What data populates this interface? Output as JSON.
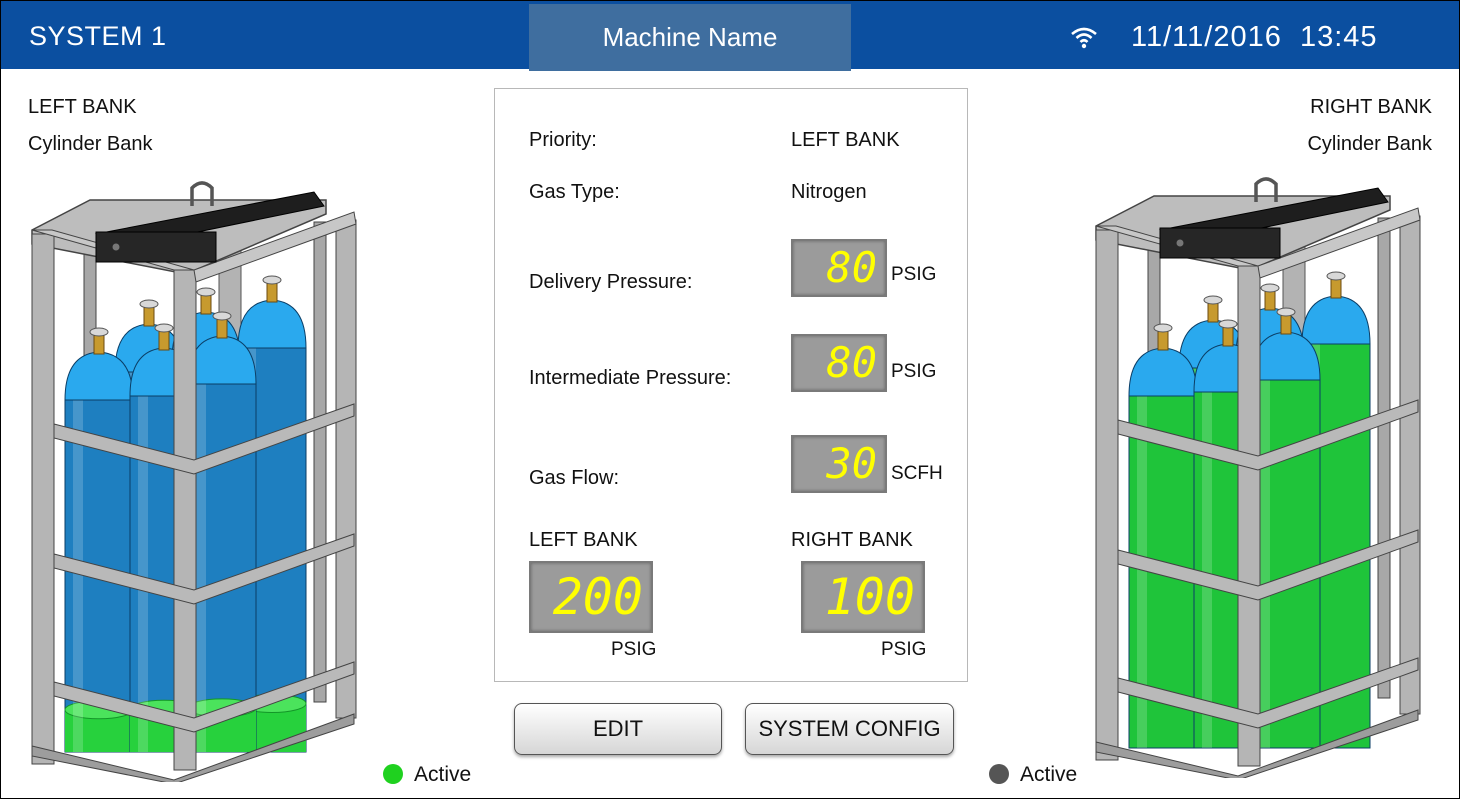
{
  "header": {
    "system_title": "SYSTEM 1",
    "machine_name": "Machine Name",
    "date": "11/11/2016",
    "time": "13:45",
    "wifi_icon": "wifi-icon",
    "bar_color": "#0b4fa0"
  },
  "left_bank": {
    "title": "LEFT BANK",
    "subtitle": "Cylinder Bank",
    "status_label": "Active",
    "status_color": "#1fd11f",
    "cylinder_color": "#1a8fd6",
    "fill_level_fraction": 0.12
  },
  "right_bank": {
    "title": "RIGHT BANK",
    "subtitle": "Cylinder Bank",
    "status_label": "Active",
    "status_color": "#555555",
    "cylinder_color": "#1fc43a",
    "fill_level_fraction": 1.0
  },
  "panel": {
    "priority_label": "Priority:",
    "priority_value": "LEFT BANK",
    "gas_type_label": "Gas Type:",
    "gas_type_value": "Nitrogen",
    "delivery_label": "Delivery Pressure:",
    "delivery_value": "80",
    "delivery_unit": "PSIG",
    "intermediate_label": "Intermediate Pressure:",
    "intermediate_value": "80",
    "intermediate_unit": "PSIG",
    "flow_label": "Gas Flow:",
    "flow_value": "30",
    "flow_unit": "SCFH",
    "left_bank_label": "LEFT BANK",
    "left_bank_value": "200",
    "left_bank_unit": "PSIG",
    "right_bank_label": "RIGHT BANK",
    "right_bank_value": "100",
    "right_bank_unit": "PSIG"
  },
  "buttons": {
    "edit": "EDIT",
    "system_config": "SYSTEM CONFIG"
  }
}
